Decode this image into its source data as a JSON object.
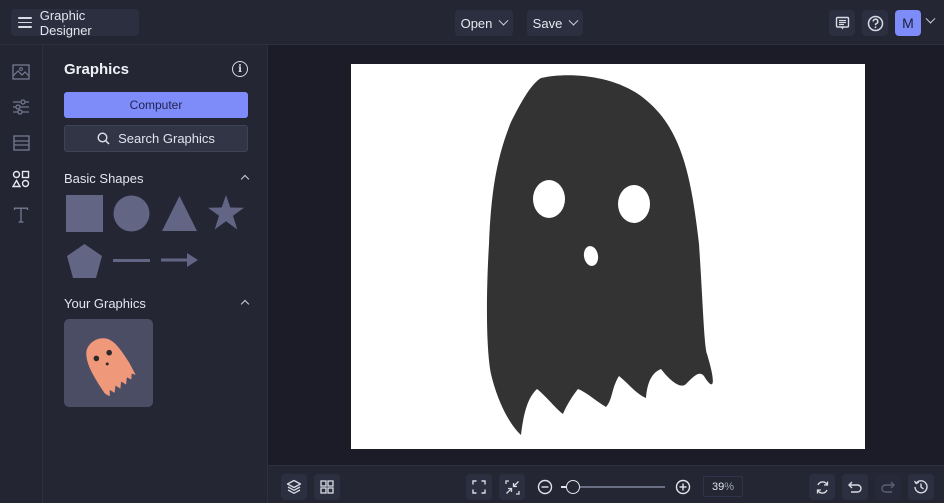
{
  "app": {
    "title": "Graphic Designer"
  },
  "topbar": {
    "open_label": "Open",
    "save_label": "Save",
    "avatar_initial": "M"
  },
  "rail": {
    "items": [
      {
        "icon": "image-icon",
        "label": "Images"
      },
      {
        "icon": "adjustments-icon",
        "label": "Adjustments"
      },
      {
        "icon": "layout-icon",
        "label": "Layout"
      },
      {
        "icon": "shapes-icon",
        "label": "Graphics",
        "active": true
      },
      {
        "icon": "text-icon",
        "label": "Text"
      }
    ]
  },
  "panel": {
    "title": "Graphics",
    "computer_button": "Computer",
    "search_button": "Search Graphics",
    "basic_shapes": {
      "title": "Basic Shapes",
      "shapes": [
        "square",
        "circle",
        "triangle",
        "star",
        "pentagon",
        "line",
        "arrow"
      ]
    },
    "your_graphics": {
      "title": "Your Graphics",
      "items": [
        {
          "name": "ghost",
          "color": "#f0987a"
        }
      ]
    }
  },
  "canvas": {
    "object": "ghost",
    "fill": "#333333",
    "background": "#ffffff"
  },
  "bottombar": {
    "zoom_value": "39",
    "zoom_unit": "%"
  },
  "colors": {
    "accent": "#7d8cf8",
    "shape_fill": "#626584"
  }
}
